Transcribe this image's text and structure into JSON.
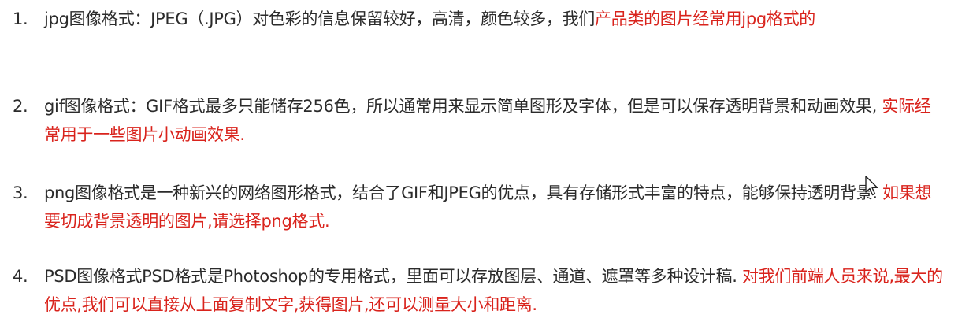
{
  "items": [
    {
      "number": "1.",
      "black": "jpg图像格式：JPEG（.JPG）对色彩的信息保留较好，高清，颜色较多，我们",
      "red": "产品类的图片经常用jpg格式的"
    },
    {
      "number": "2.",
      "black": "gif图像格式：GIF格式最多只能储存256色，所以通常用来显示简单图形及字体，但是可以保存透明背景和动画效果, ",
      "red": "实际经常用于一些图片小动画效果."
    },
    {
      "number": "3.",
      "black": "png图像格式是一种新兴的网络图形格式，结合了GIF和JPEG的优点，具有存储形式丰富的特点，能够保持透明背景. ",
      "red": "如果想要切成背景透明的图片,请选择png格式."
    },
    {
      "number": "4.",
      "black": "PSD图像格式PSD格式是Photoshop的专用格式，里面可以存放图层、通道、遮罩等多种设计稿. ",
      "red": "对我们前端人员来说,最大的优点,我们可以直接从上面复制文字,获得图片,还可以测量大小和距离."
    }
  ],
  "colors": {
    "text": "#2b2b2b",
    "highlight": "#d9231c",
    "background": "#ffffff"
  },
  "icons": {
    "cursor": "mouse-pointer-icon"
  }
}
